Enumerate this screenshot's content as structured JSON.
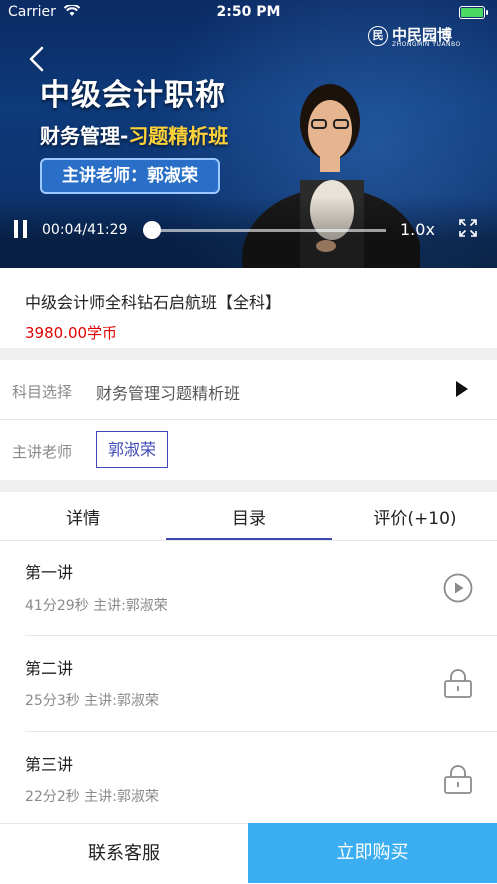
{
  "status_bar": {
    "carrier": "Carrier",
    "time": "2:50 PM",
    "wifi_icon": "wifi-icon",
    "battery_icon": "battery-icon",
    "battery_color": "#4cd964"
  },
  "video": {
    "logo_name": "中民园博",
    "logo_sub": "ZHONGMIN YUANBO",
    "logo_seal": "民",
    "title_line1": "中级会计职称",
    "title_line2_prefix": "财务管理-",
    "title_line2_highlight": "习题精析班",
    "teacher_badge": "主讲老师：郭淑荣",
    "time_readout": "00:04/41:29",
    "progress": 0.0016,
    "speed": "1.0x",
    "back_icon": "chevron-left-icon",
    "pause_icon": "pause-icon",
    "fullscreen_icon": "fullscreen-icon"
  },
  "course": {
    "name": "中级会计师全科钻石启航班【全科】",
    "price": "3980.00学币",
    "price_color": "#e30000"
  },
  "options": {
    "subject_label": "科目选择",
    "subject_value": "财务管理习题精析班",
    "teacher_label": "主讲老师",
    "teacher_value": "郭淑荣",
    "accent_color": "#3f49b5"
  },
  "tabs": [
    {
      "label": "详情"
    },
    {
      "label": "目录",
      "active": true
    },
    {
      "label": "评价(+10)"
    }
  ],
  "lessons": [
    {
      "title": "第一讲",
      "meta": "41分29秒 主讲:郭淑荣",
      "icon": "play-circle-icon"
    },
    {
      "title": "第二讲",
      "meta": "25分3秒 主讲:郭淑荣",
      "icon": "lock-icon"
    },
    {
      "title": "第三讲",
      "meta": "22分2秒 主讲:郭淑荣",
      "icon": "lock-icon"
    }
  ],
  "bottom_bar": {
    "contact_label": "联系客服",
    "buy_label": "立即购买",
    "buy_color": "#3aaef0"
  }
}
